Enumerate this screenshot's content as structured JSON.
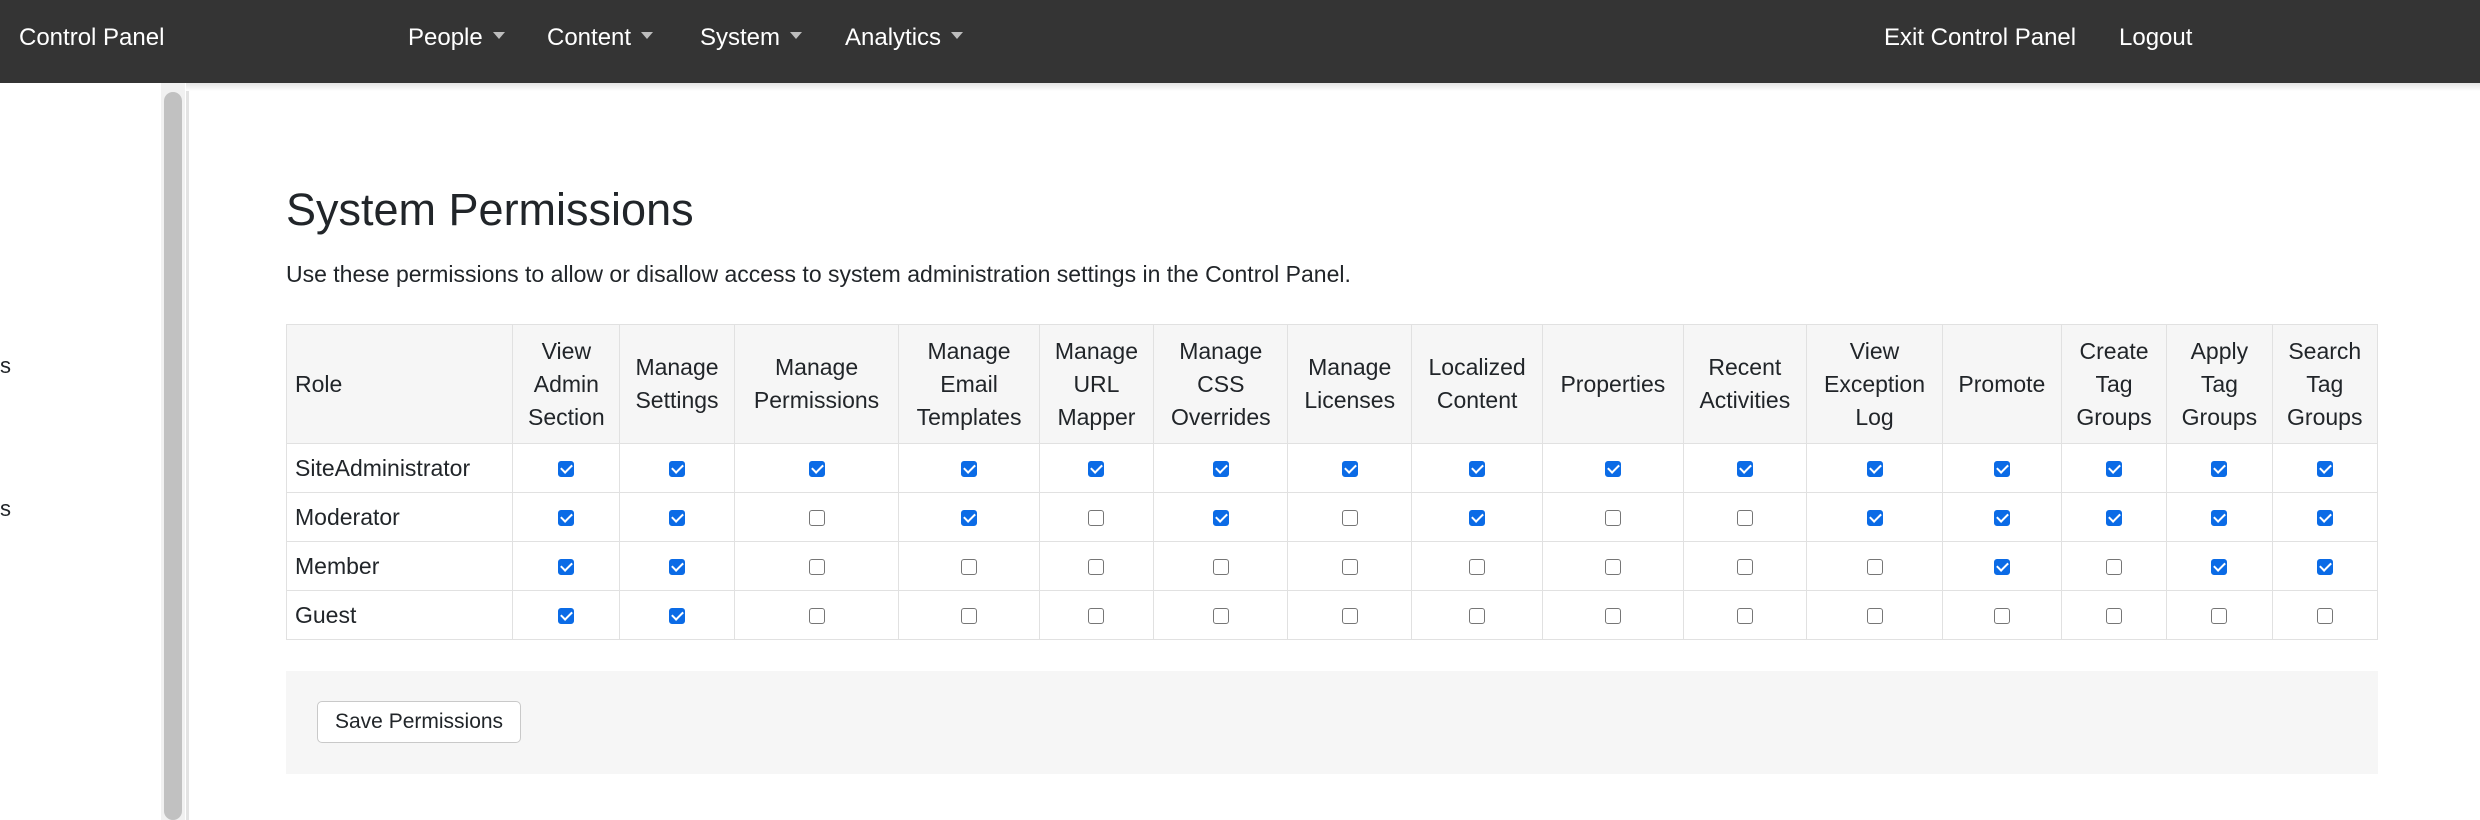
{
  "navbar": {
    "brand": "Control Panel",
    "menus": [
      "People",
      "Content",
      "System",
      "Analytics"
    ],
    "exit_label": "Exit Control Panel",
    "logout_label": "Logout"
  },
  "sidebar": {
    "fragments": [
      "s",
      "s"
    ]
  },
  "page": {
    "title": "System Permissions",
    "description": "Use these permissions to allow or disallow access to system administration settings in the Control Panel."
  },
  "table": {
    "role_header": "Role",
    "columns": [
      [
        "View",
        "Admin",
        "Section"
      ],
      [
        "Manage",
        "Settings"
      ],
      [
        "Manage",
        "Permissions"
      ],
      [
        "Manage",
        "Email",
        "Templates"
      ],
      [
        "Manage",
        "URL",
        "Mapper"
      ],
      [
        "Manage",
        "CSS",
        "Overrides"
      ],
      [
        "Manage",
        "Licenses"
      ],
      [
        "Localized",
        "Content"
      ],
      [
        "Properties"
      ],
      [
        "Recent",
        "Activities"
      ],
      [
        "View",
        "Exception",
        "Log"
      ],
      [
        "Promote"
      ],
      [
        "Create",
        "Tag",
        "Groups"
      ],
      [
        "Apply",
        "Tag",
        "Groups"
      ],
      [
        "Search",
        "Tag",
        "Groups"
      ]
    ],
    "rows": [
      {
        "role": "SiteAdministrator",
        "checked": [
          true,
          true,
          true,
          true,
          true,
          true,
          true,
          true,
          true,
          true,
          true,
          true,
          true,
          true,
          true
        ]
      },
      {
        "role": "Moderator",
        "checked": [
          true,
          true,
          false,
          true,
          false,
          true,
          false,
          true,
          false,
          false,
          true,
          true,
          true,
          true,
          true
        ]
      },
      {
        "role": "Member",
        "checked": [
          true,
          true,
          false,
          false,
          false,
          false,
          false,
          false,
          false,
          false,
          false,
          true,
          false,
          true,
          true
        ]
      },
      {
        "role": "Guest",
        "checked": [
          true,
          true,
          false,
          false,
          false,
          false,
          false,
          false,
          false,
          false,
          false,
          false,
          false,
          false,
          false
        ]
      }
    ]
  },
  "actions": {
    "save_label": "Save Permissions"
  },
  "colors": {
    "navbar_bg": "#343434",
    "checkbox_checked": "#0b6be6",
    "header_bg": "#f6f6f6"
  }
}
